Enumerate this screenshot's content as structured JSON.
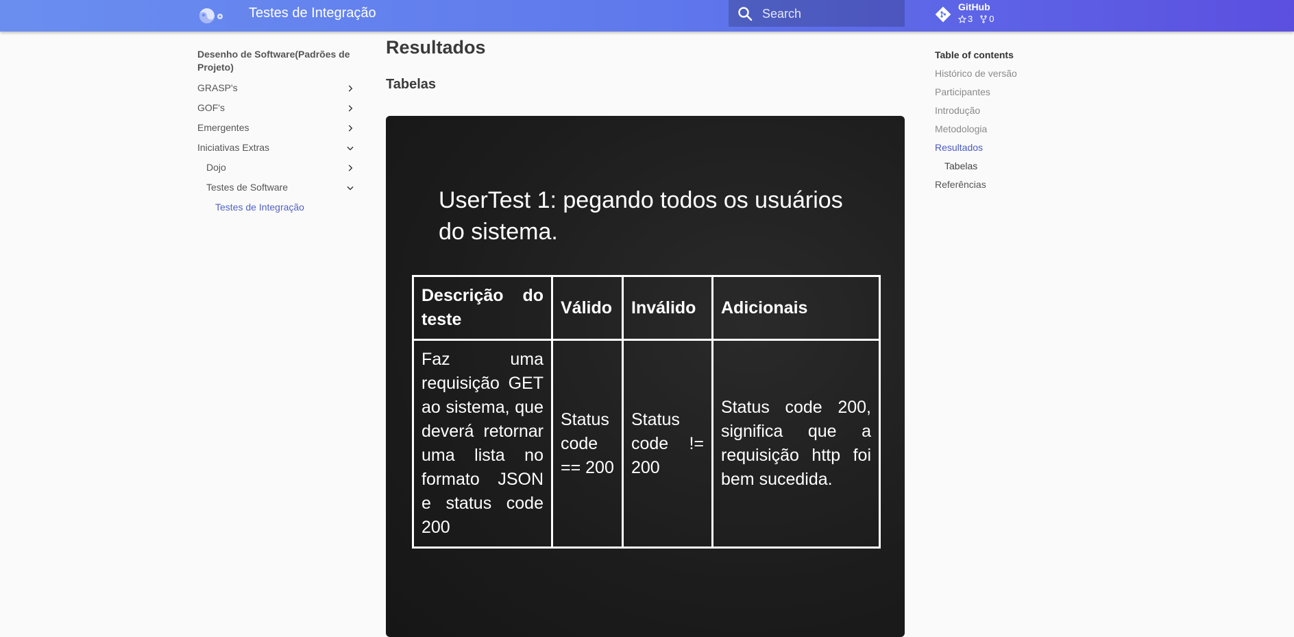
{
  "header": {
    "title": "Testes de Integração",
    "search_placeholder": "Search",
    "repo_name": "GitHub",
    "stars": "3",
    "forks": "0"
  },
  "nav": {
    "section_title": "Desenho de Software(Padrões de Projeto)",
    "items": [
      {
        "label": "GRASP's",
        "icon": "chevron-right-icon"
      },
      {
        "label": "GOF's",
        "icon": "chevron-right-icon"
      },
      {
        "label": "Emergentes",
        "icon": "chevron-right-icon"
      },
      {
        "label": "Iniciativas Extras",
        "icon": "chevron-down-icon"
      },
      {
        "label": "Dojo",
        "icon": "chevron-right-icon"
      },
      {
        "label": "Testes de Software",
        "icon": "chevron-down-icon"
      },
      {
        "label": "Testes de Integração"
      }
    ]
  },
  "main": {
    "heading": "Resultados",
    "subheading": "Tabelas",
    "board": {
      "title": "UserTest 1:  pegando todos os usuários do sistema.",
      "headers": [
        "Descrição do teste",
        "Válido",
        "Inválido",
        "Adicionais"
      ],
      "row": [
        "Faz uma requisição GET ao sistema, que deverá retornar uma lista no formato JSON e status code 200",
        "Status code == 200",
        "Status code != 200",
        "Status code 200, significa que a requisição http foi bem sucedida."
      ]
    }
  },
  "toc": {
    "title": "Table of contents",
    "items": [
      "Histórico de versão",
      "Participantes",
      "Introdução",
      "Metodologia",
      "Resultados",
      "Tabelas",
      "Referências"
    ]
  },
  "colors": {
    "header_start": "#6a8ef0",
    "header_end": "#5b4fe0",
    "accent": "#4a59c2",
    "board_bg": "#1d1d1d"
  }
}
